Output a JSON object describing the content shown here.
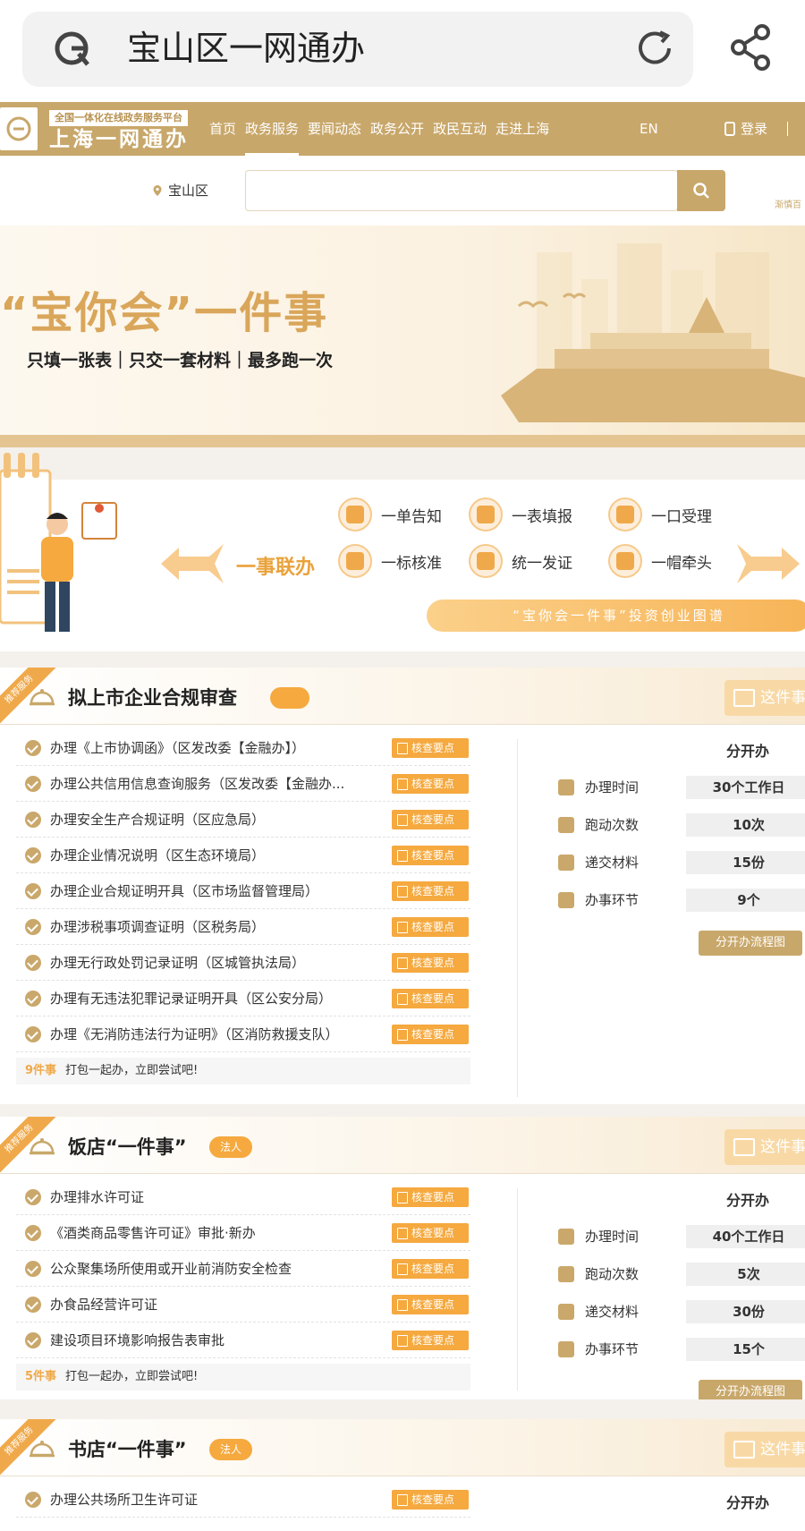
{
  "browser": {
    "url_title": "宝山区一网通办"
  },
  "site": {
    "tagline": "全国一体化在线政务服务平台",
    "name": "上海一网通办",
    "nav": [
      "首页",
      "政务服务",
      "要闻动态",
      "政务公开",
      "政民互动",
      "走进上海"
    ],
    "lang": "EN",
    "login": "登录",
    "region": "宝山区",
    "search_placeholder": "",
    "right_hint": "渐慎百"
  },
  "banner": {
    "title": "“宝你会”一件事",
    "subtitle": "只填一张表｜只交一套材料｜最多跑一次"
  },
  "promo": {
    "title": "一事联办",
    "features": [
      "一单告知",
      "一表填报",
      "一口受理",
      "一标核准",
      "统一发证",
      "一帽牵头"
    ],
    "link": "“宝你会一件事”投资创业图谱"
  },
  "common": {
    "ribbon": "推荐服务",
    "check_btn": "核查要点",
    "this_btn": "这件事",
    "split_title": "分开办",
    "flow_btn": "分开办流程图",
    "footer_tail": "打包一起办，立即尝试吧!",
    "stat_labels": [
      "办理时间",
      "跑动次数",
      "递交材料",
      "办事环节"
    ]
  },
  "cards": [
    {
      "title": "拟上市企业合规审查",
      "badge": "",
      "items": [
        "办理《上市协调函》（区发改委【金融办】）",
        "办理公共信用信息查询服务（区发改委【金融办...",
        "办理安全生产合规证明（区应急局）",
        "办理企业情况说明（区生态环境局）",
        "办理企业合规证明开具（区市场监督管理局）",
        "办理涉税事项调查证明（区税务局）",
        "办理无行政处罚记录证明（区城管执法局）",
        "办理有无违法犯罪记录证明开具（区公安分局）",
        "办理《无消防违法行为证明》（区消防救援支队）"
      ],
      "count": "9件事",
      "stats": [
        "30个工作日",
        "10次",
        "15份",
        "9个"
      ]
    },
    {
      "title": "饭店“一件事”",
      "badge": "法人",
      "items": [
        "办理排水许可证",
        "《酒类商品零售许可证》审批·新办",
        "公众聚集场所使用或开业前消防安全检查",
        "办食品经营许可证",
        "建设项目环境影响报告表审批"
      ],
      "count": "5件事",
      "stats": [
        "40个工作日",
        "5次",
        "30份",
        "15个"
      ]
    },
    {
      "title": "书店“一件事”",
      "badge": "法人",
      "items": [
        "办理公共场所卫生许可证"
      ]
    }
  ]
}
